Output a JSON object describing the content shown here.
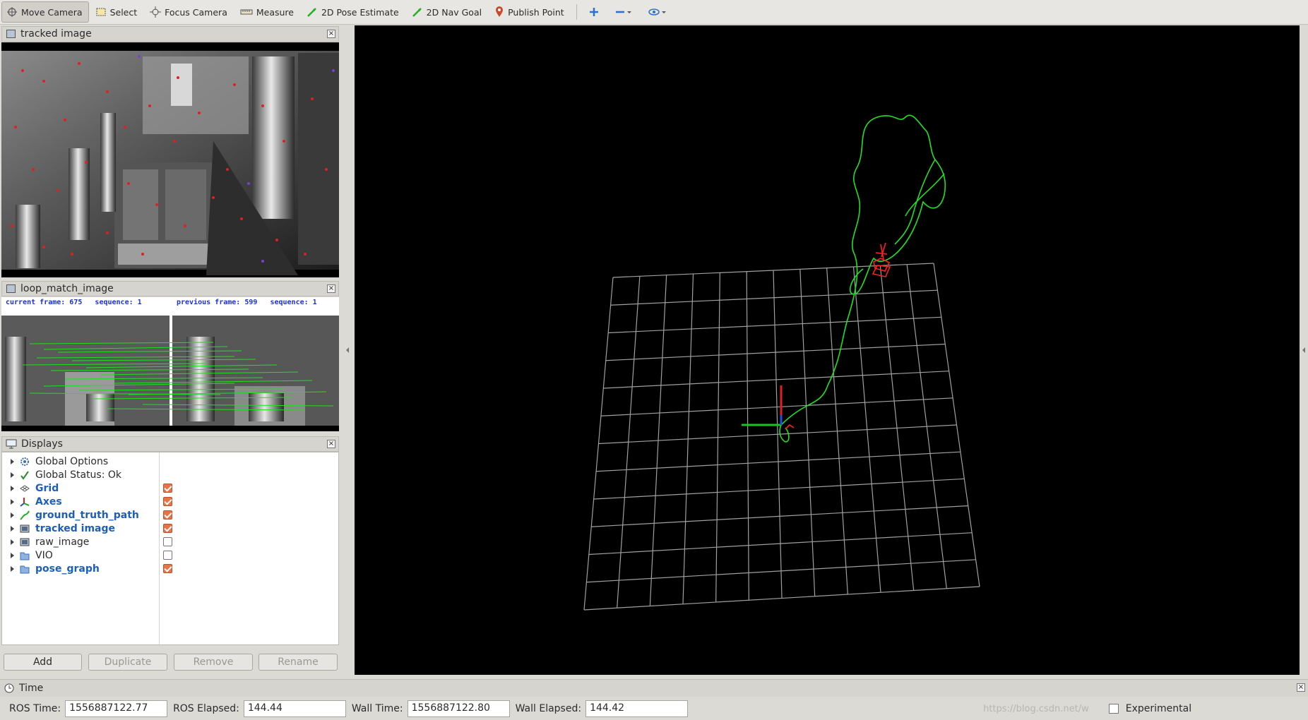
{
  "toolbar": {
    "tools": [
      {
        "label": "Move Camera",
        "icon": "move-camera-icon"
      },
      {
        "label": "Select",
        "icon": "select-icon"
      },
      {
        "label": "Focus Camera",
        "icon": "focus-camera-icon"
      },
      {
        "label": "Measure",
        "icon": "measure-icon"
      },
      {
        "label": "2D Pose Estimate",
        "icon": "pose-estimate-icon"
      },
      {
        "label": "2D Nav Goal",
        "icon": "nav-goal-icon"
      },
      {
        "label": "Publish Point",
        "icon": "publish-point-icon"
      }
    ],
    "extra_icons": [
      "add-tool-icon",
      "remove-tool-icon",
      "view-eye-icon"
    ]
  },
  "panels": {
    "tracked_image_title": "tracked image",
    "loop_match_title": "loop_match_image",
    "loop_header_left": "current frame: 675   sequence: 1",
    "loop_header_right": "previous frame: 599   sequence: 1"
  },
  "displays": {
    "title": "Displays",
    "items": [
      {
        "label": "Global Options",
        "icon": "gear-icon",
        "checked": null,
        "highlight": false
      },
      {
        "label": "Global Status: Ok",
        "icon": "checkmark-icon",
        "checked": null,
        "highlight": false
      },
      {
        "label": "Grid",
        "icon": "grid-icon",
        "checked": true,
        "highlight": true
      },
      {
        "label": "Axes",
        "icon": "axes-icon",
        "checked": true,
        "highlight": true
      },
      {
        "label": "ground_truth_path",
        "icon": "path-icon",
        "checked": true,
        "highlight": true
      },
      {
        "label": "tracked image",
        "icon": "image-icon",
        "checked": true,
        "highlight": true
      },
      {
        "label": "raw_image",
        "icon": "image-icon",
        "checked": false,
        "highlight": false
      },
      {
        "label": "VIO",
        "icon": "folder-icon",
        "checked": false,
        "highlight": false
      },
      {
        "label": "pose_graph",
        "icon": "folder-icon",
        "checked": true,
        "highlight": true
      }
    ],
    "buttons": {
      "add": "Add",
      "duplicate": "Duplicate",
      "remove": "Remove",
      "rename": "Rename"
    }
  },
  "time": {
    "title": "Time",
    "ros_time_label": "ROS Time:",
    "ros_time": "1556887122.77",
    "ros_elapsed_label": "ROS Elapsed:",
    "ros_elapsed": "144.44",
    "wall_time_label": "Wall Time:",
    "wall_time": "1556887122.80",
    "wall_elapsed_label": "Wall Elapsed:",
    "wall_elapsed": "144.42",
    "experimental_label": "Experimental",
    "watermark": "https://blog.csdn.net/w"
  },
  "colors": {
    "path": "#22e022",
    "pose_graph": "#ff2020",
    "grid": "#a0a0a0",
    "accent": "#1d5fb8"
  }
}
